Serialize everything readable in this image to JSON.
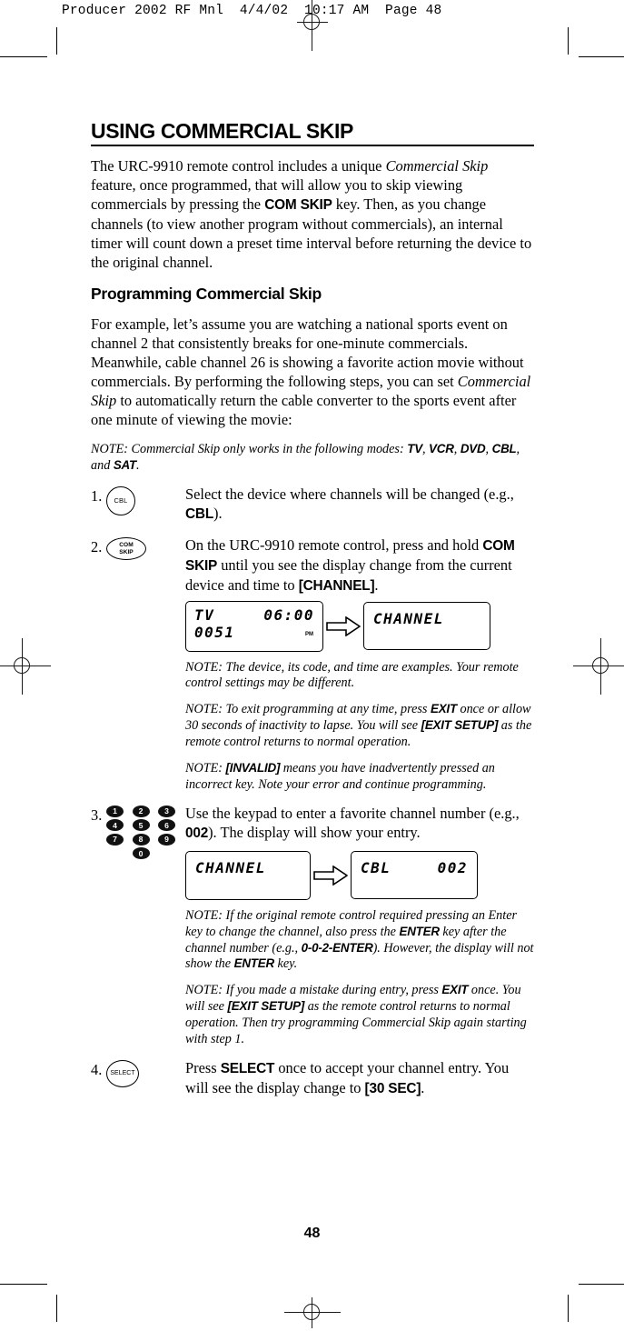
{
  "printer_slug": "Producer 2002 RF Mnl  4/4/02  10:17 AM  Page 48",
  "page_number": "48",
  "title": "USING COMMERCIAL SKIP",
  "intro": {
    "p1_a": "The URC-9910 remote control includes a unique ",
    "p1_italic": "Commercial Skip",
    "p1_b": " feature, once programmed,  that will allow you to skip viewing commercials by pressing the ",
    "p1_bold": "COM SKIP",
    "p1_c": " key. Then, as you change channels (to view another program without commercials), an internal timer will count down a preset time interval before returning the device to the original channel."
  },
  "subhead": "Programming Commercial Skip",
  "example": {
    "a": "For example, let’s assume you are watching a national sports event on channel 2 that consistently breaks for one-minute commercials. Meanwhile, cable channel 26 is showing a favorite action movie without commercials. By performing the following steps, you can set ",
    "italic": "Commercial Skip",
    "b": " to automatically return the cable converter to the sports event after one minute of viewing the movie:"
  },
  "mode_note": {
    "a": "NOTE: Commercial Skip only works in the following modes: ",
    "m1": "TV",
    "sep1": ", ",
    "m2": "VCR",
    "sep2": ", ",
    "m3": "DVD",
    "sep3": ", ",
    "m4": "CBL",
    "sep4": ", and ",
    "m5": "SAT",
    "end": "."
  },
  "steps": [
    {
      "num": "1.",
      "icon": "cbl-key",
      "icon_label": "CBL",
      "text_a": "Select the device where channels will be changed (e.g., ",
      "text_bold": "CBL",
      "text_b": ")."
    },
    {
      "num": "2.",
      "icon": "com-skip-key",
      "icon_label_line1": "COM",
      "icon_label_line2": "SKIP",
      "text_a": "On the URC-9910 remote control, press and hold ",
      "text_bold1": "COM SKIP",
      "text_b": " until you see the display change from the current device and time to ",
      "text_bold2": "[CHANNEL]",
      "text_c": "."
    },
    {
      "num": "3.",
      "icon": "number-keypad",
      "text_a": "Use the keypad to enter a favorite channel number (e.g., ",
      "text_bold": "002",
      "text_b": "). The display will show your entry."
    },
    {
      "num": "4.",
      "icon": "select-key",
      "icon_label": "SELECT",
      "text_a": "Press ",
      "text_bold1": "SELECT",
      "text_b": " once to accept your channel entry. You will see the display change to ",
      "text_bold2": "[30 SEC]",
      "text_c": "."
    }
  ],
  "keypad_digits": [
    [
      "1",
      "2",
      "3"
    ],
    [
      "4",
      "5",
      "6"
    ],
    [
      "7",
      "8",
      "9"
    ],
    [
      "0"
    ]
  ],
  "lcd_step2": {
    "before": {
      "device": "TV",
      "time": "06:00",
      "code": "0051",
      "meridiem": "PM"
    },
    "after": {
      "text": "CHANNEL"
    }
  },
  "lcd_step3": {
    "before": {
      "text": "CHANNEL"
    },
    "after": {
      "device": "CBL",
      "channel": "002"
    }
  },
  "notes_step2": [
    {
      "a": "NOTE: The device, its code, and time are examples. Your remote control settings may be different."
    },
    {
      "a": "NOTE: To exit programming at any time, press ",
      "b1": "EXIT",
      "b": " once or allow 30 seconds of inactivity to lapse. You will see ",
      "b2": "[EXIT SETUP]",
      "c": " as the remote control returns to normal operation."
    },
    {
      "a": "NOTE: ",
      "b1": "[INVALID]",
      "b": " means you have inadvertently pressed an incorrect key. Note your error and continue programming."
    }
  ],
  "notes_step3": [
    {
      "a": "NOTE: If the original remote control required pressing an Enter key to change the channel, also press the ",
      "b1": "ENTER",
      "b": " key after the channel number (e.g., ",
      "b2": "0-0-2-ENTER",
      "c": "). However, the display will not show the ",
      "b3": "ENTER",
      "d": " key."
    },
    {
      "a": "NOTE: If you made a mistake during entry, press ",
      "b1": "EXIT",
      "b": " once. You will see ",
      "b2": "[EXIT SETUP]",
      "c": " as the remote control returns to normal operation. Then try programming Commercial Skip again starting with step 1."
    }
  ]
}
